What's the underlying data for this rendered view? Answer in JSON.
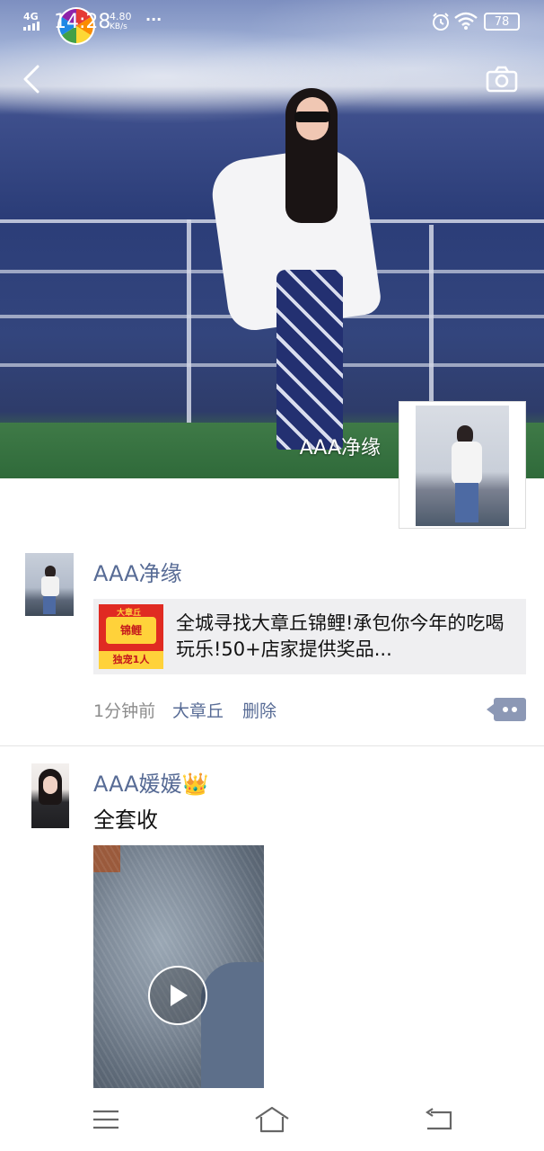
{
  "status_bar": {
    "network": "4G",
    "time": "14:28",
    "speed_value": "4.80",
    "speed_unit": "KB/s",
    "more": "···",
    "battery": "78"
  },
  "header": {
    "back_icon": "back-arrow-icon",
    "camera_icon": "camera-icon"
  },
  "profile": {
    "name": "AAA净缘"
  },
  "feed": [
    {
      "author": "AAA净缘",
      "link_card": {
        "thumb_top": "大章丘",
        "thumb_title": "锦鲤",
        "thumb_bottom": "独宠1人",
        "text": "全城寻找大章丘锦鲤!承包你今年的吃喝玩乐!50+店家提供奖品..."
      },
      "time": "1分钟前",
      "location": "大章丘",
      "delete_label": "删除"
    },
    {
      "author": "AAA媛媛",
      "author_badge": "👑",
      "text": "全套收",
      "media": "video"
    }
  ],
  "nav": {
    "menu_icon": "menu-icon",
    "home_icon": "home-icon",
    "back_icon": "back-icon"
  }
}
